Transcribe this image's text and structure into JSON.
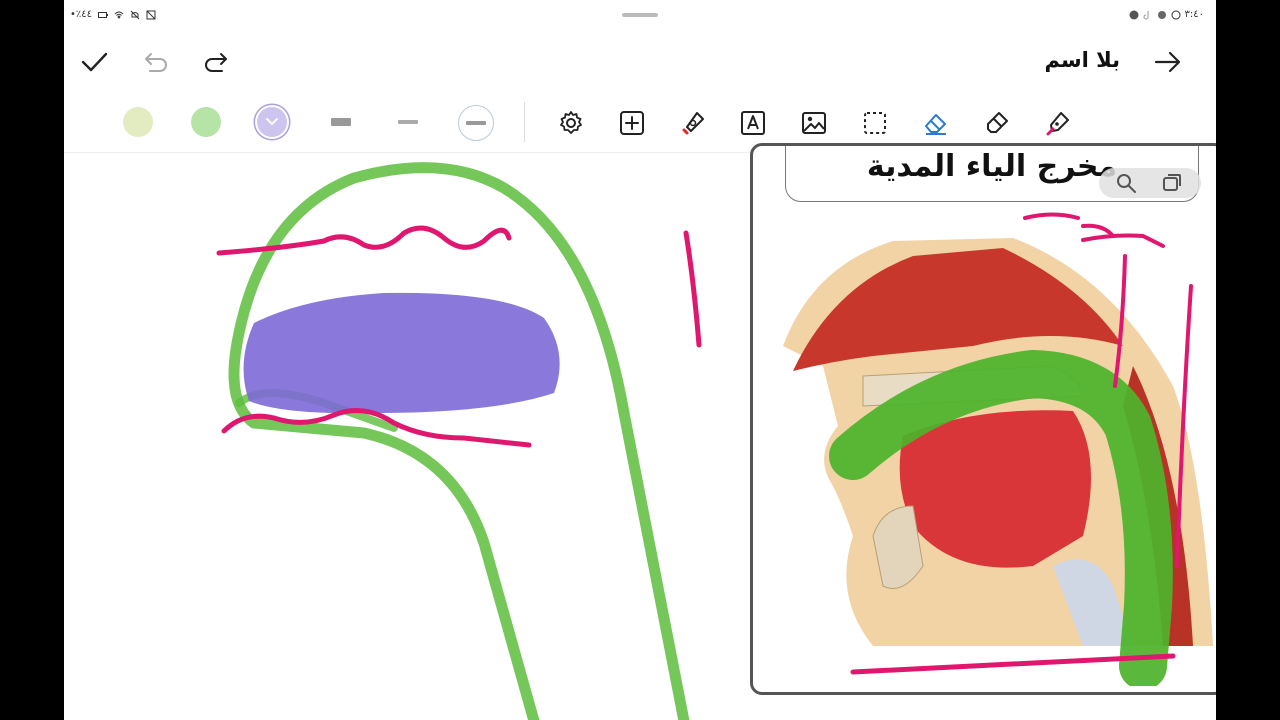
{
  "status": {
    "left_text": "•٪٤٤",
    "right_text": "٣:٤٠"
  },
  "header": {
    "title": "بلا اسم"
  },
  "card": {
    "title": "مخرج الياء المدية"
  },
  "colors": {
    "swatch_1": "#e3ebc0",
    "swatch_2": "#b6e3a6",
    "swatch_3": "#cdc4ef",
    "accent_pink": "#e0176f",
    "accent_green": "#5dbd3c",
    "accent_purple": "#7d69d6"
  },
  "icons": [
    "check-icon",
    "undo-icon",
    "redo-icon",
    "forward-arrow-icon",
    "settings-icon",
    "add-box-icon",
    "highlighter-tool-icon",
    "text-box-icon",
    "image-icon",
    "lasso-select-icon",
    "eraser-icon",
    "marker-icon",
    "pen-icon",
    "zoom-icon",
    "copy-icon"
  ]
}
